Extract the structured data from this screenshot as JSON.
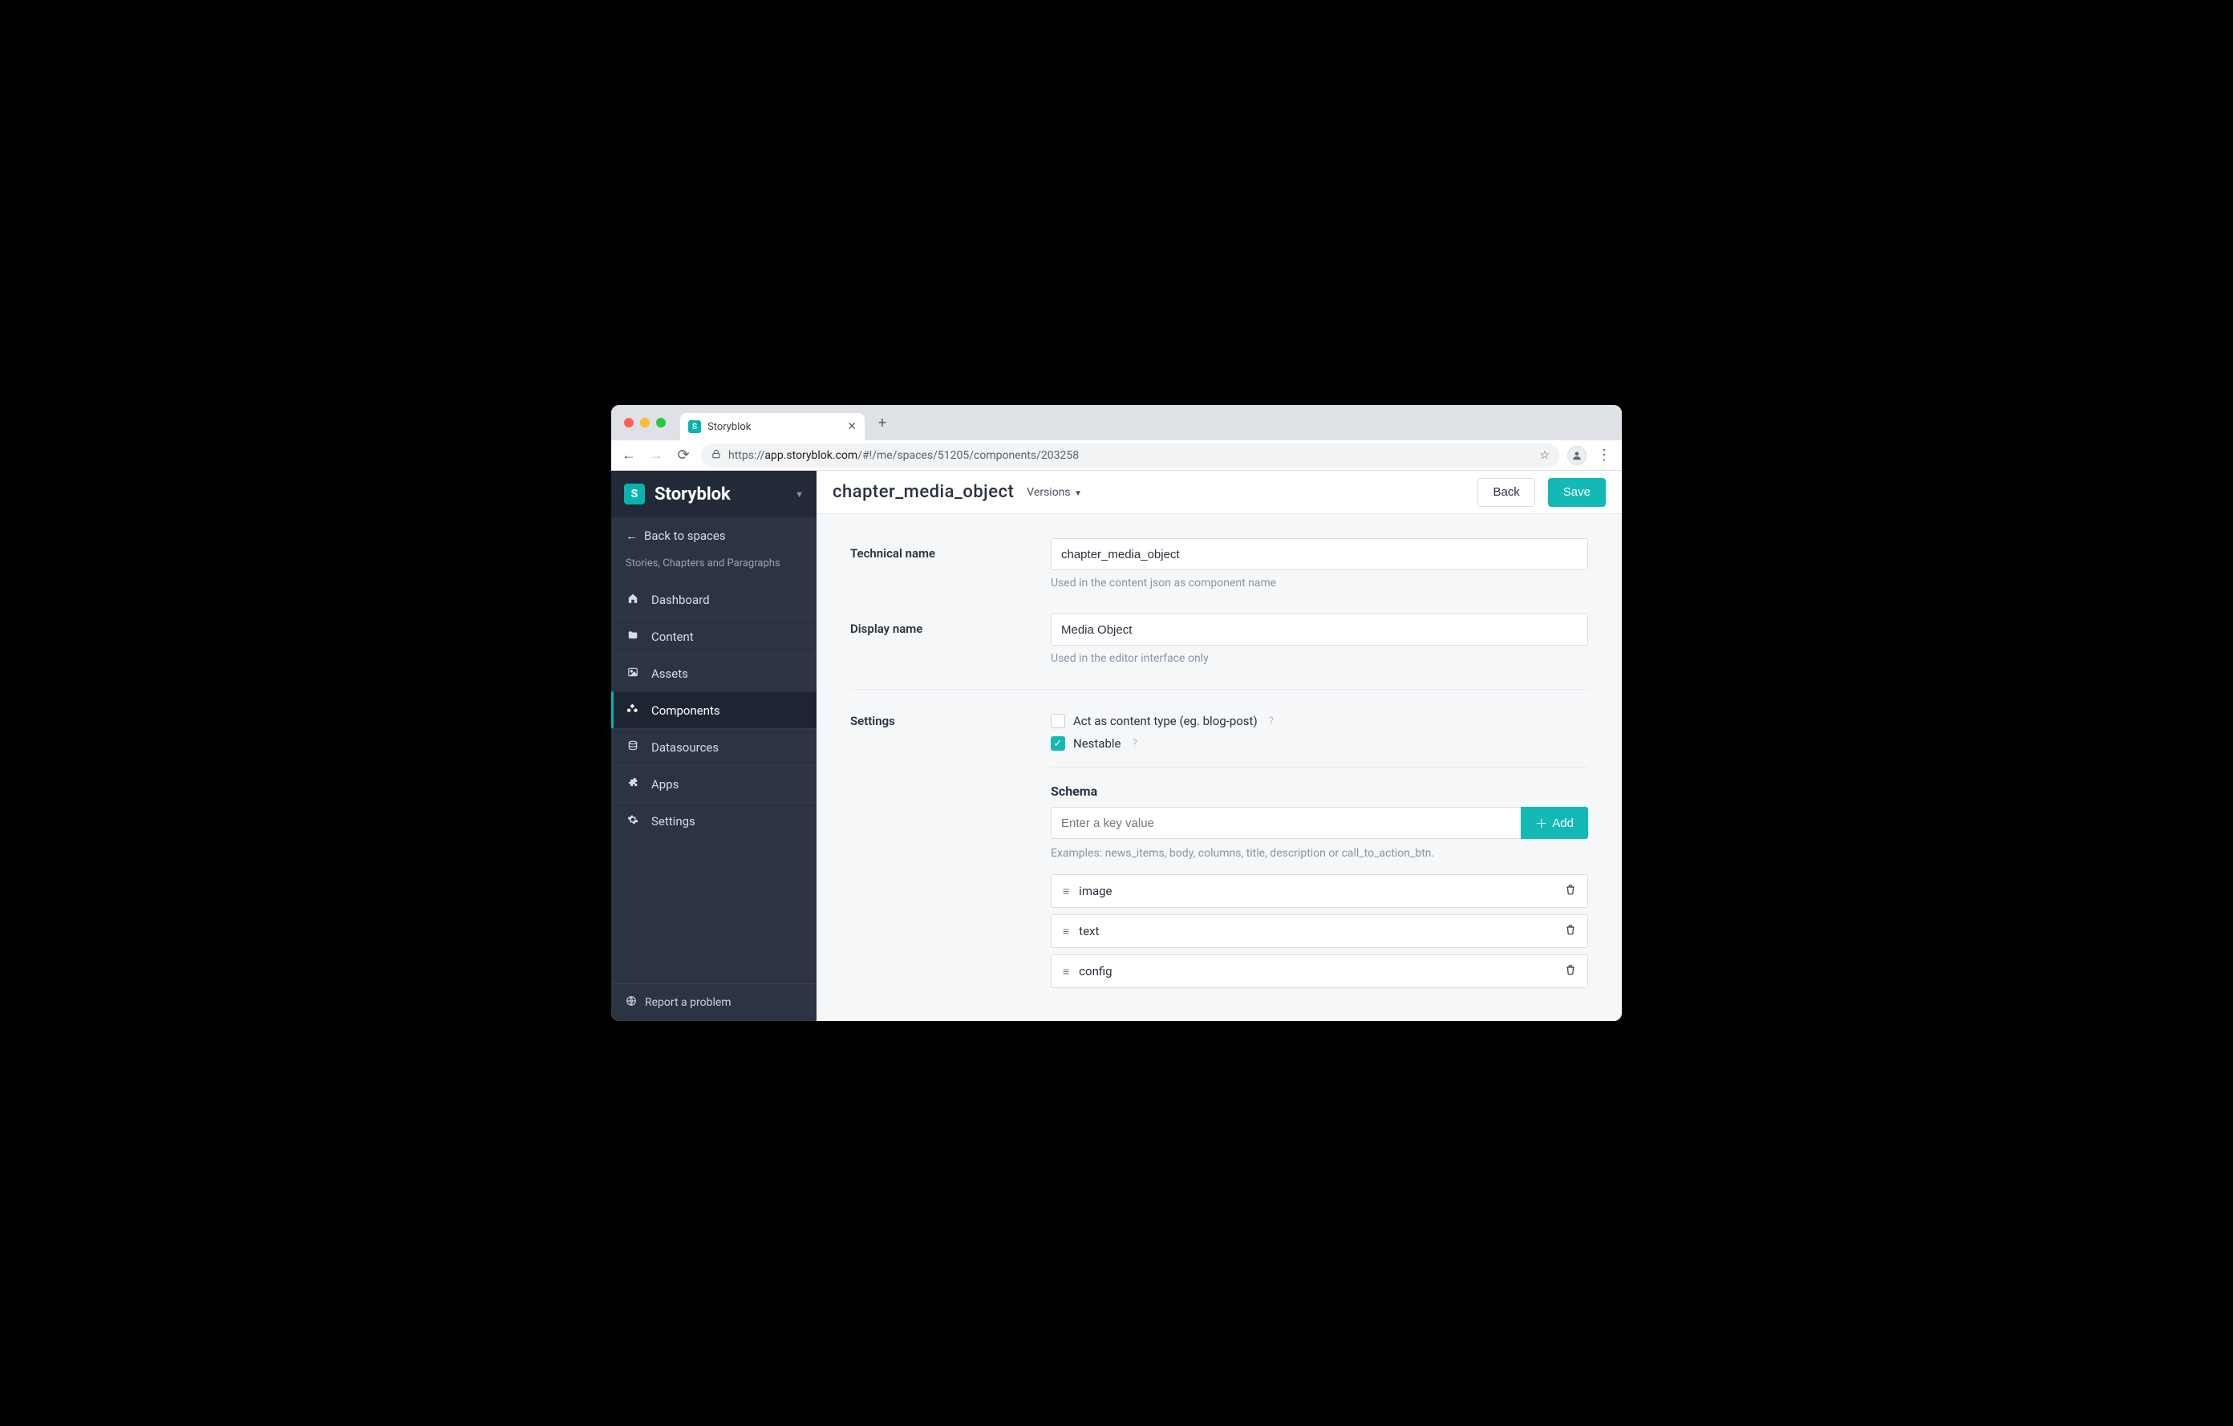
{
  "browser": {
    "tab_title": "Storyblok",
    "url_scheme": "https://",
    "url_host": "app.storyblok.com",
    "url_path": "/#!/me/spaces/51205/components/203258"
  },
  "sidebar": {
    "brand": "Storyblok",
    "back_link": "Back to spaces",
    "space_name": "Stories, Chapters and Paragraphs",
    "items": [
      {
        "label": "Dashboard",
        "active": false
      },
      {
        "label": "Content",
        "active": false
      },
      {
        "label": "Assets",
        "active": false
      },
      {
        "label": "Components",
        "active": true
      },
      {
        "label": "Datasources",
        "active": false
      },
      {
        "label": "Apps",
        "active": false
      },
      {
        "label": "Settings",
        "active": false
      }
    ],
    "footer": "Report a problem"
  },
  "topbar": {
    "title": "chapter_media_object",
    "versions_label": "Versions",
    "back_label": "Back",
    "save_label": "Save"
  },
  "form": {
    "technical_name_label": "Technical name",
    "technical_name_value": "chapter_media_object",
    "technical_name_help": "Used in the content json as component name",
    "display_name_label": "Display name",
    "display_name_value": "Media Object",
    "display_name_help": "Used in the editor interface only",
    "settings_label": "Settings",
    "checkbox_content_type_label": "Act as content type (eg. blog-post)",
    "checkbox_content_type_checked": false,
    "checkbox_nestable_label": "Nestable",
    "checkbox_nestable_checked": true,
    "schema_label": "Schema",
    "schema_input_placeholder": "Enter a key value",
    "schema_add_label": "Add",
    "schema_examples": "Examples: news_items, body, columns, title, description or call_to_action_btn.",
    "schema_items": [
      {
        "name": "image"
      },
      {
        "name": "text"
      },
      {
        "name": "config"
      }
    ]
  },
  "colors": {
    "accent": "#13b9b4"
  }
}
